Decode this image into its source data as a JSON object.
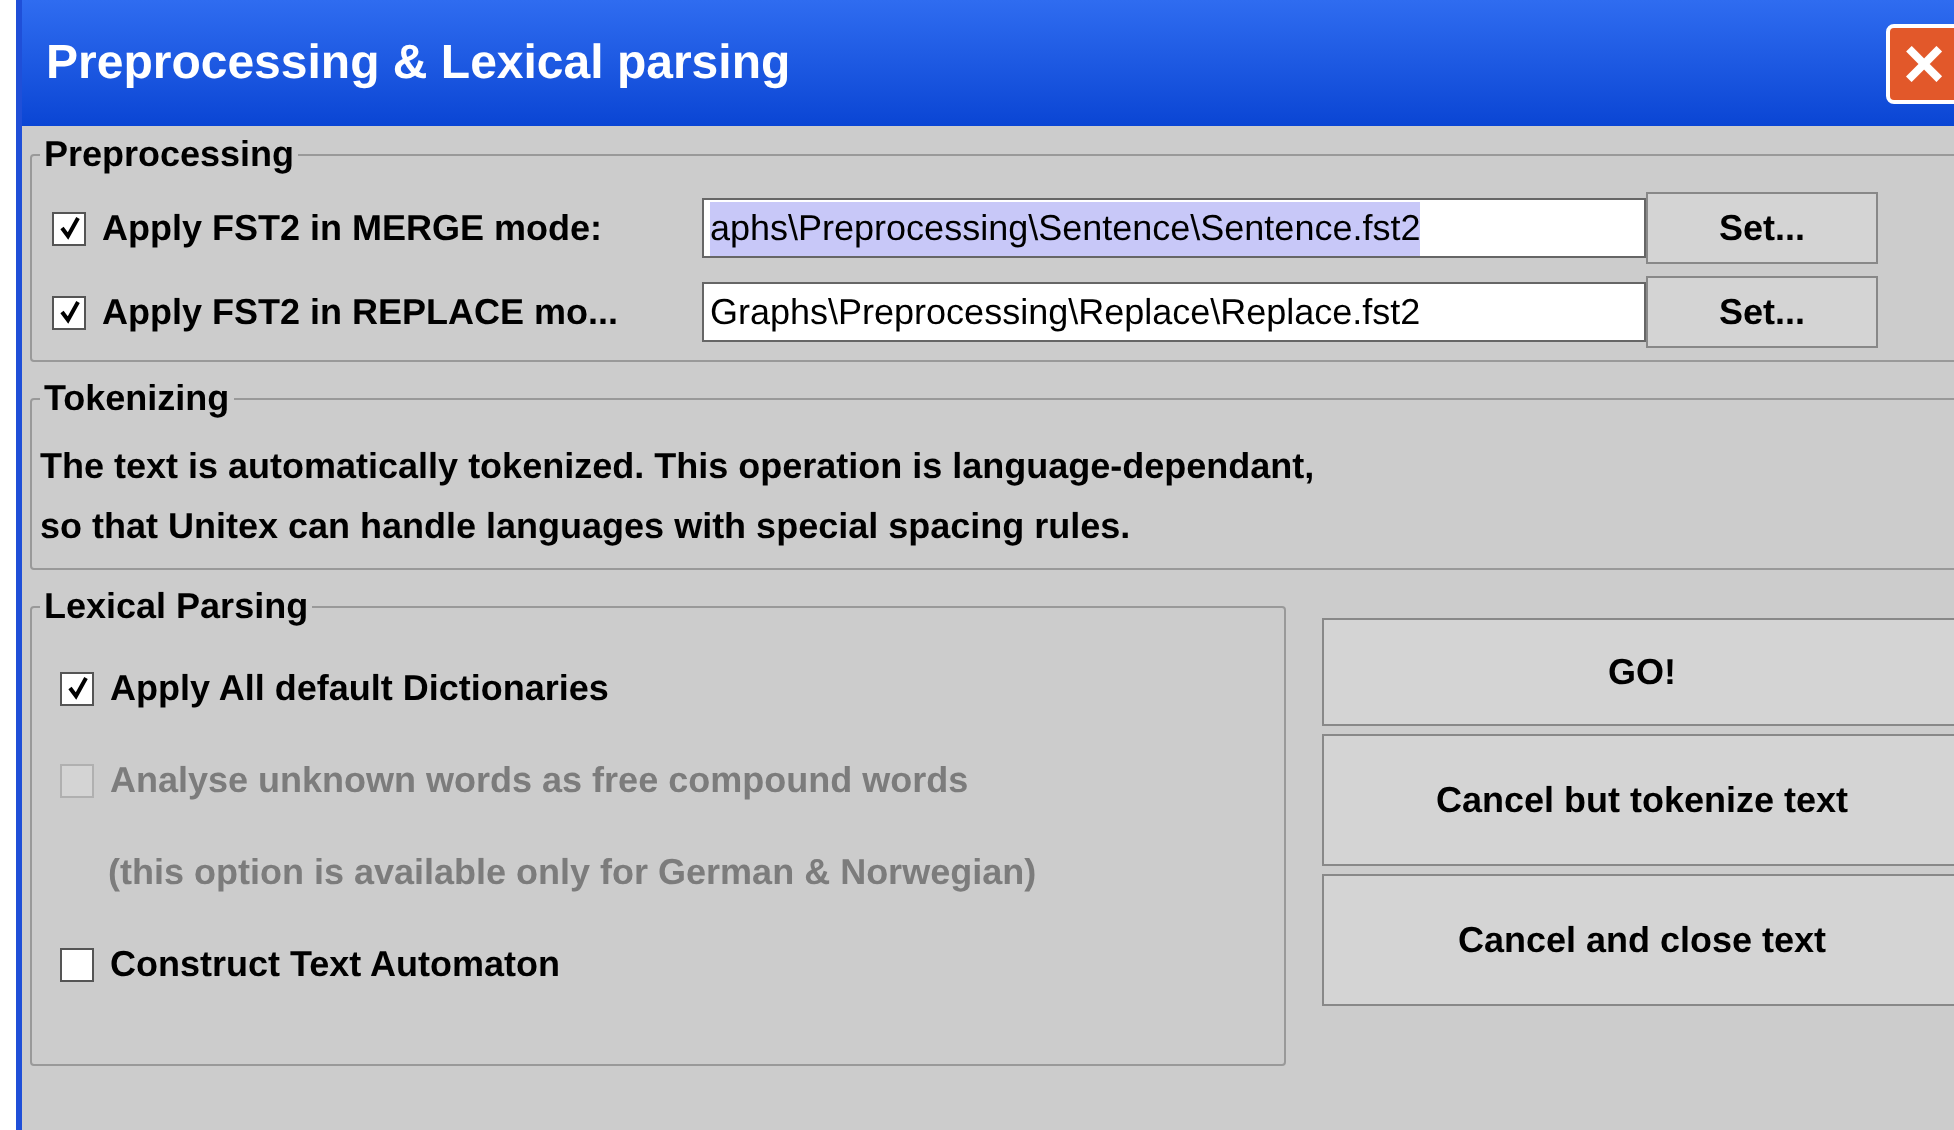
{
  "window": {
    "title": "Preprocessing & Lexical parsing",
    "close": "×"
  },
  "preprocessing": {
    "title": "Preprocessing",
    "rows": [
      {
        "label": "Apply FST2 in MERGE mode:",
        "checked": true,
        "path": "aphs\\Preprocessing\\Sentence\\Sentence.fst2",
        "selected": true,
        "button": "Set..."
      },
      {
        "label": "Apply FST2 in REPLACE mo...",
        "checked": true,
        "path": "Graphs\\Preprocessing\\Replace\\Replace.fst2",
        "selected": false,
        "button": "Set..."
      }
    ]
  },
  "tokenizing": {
    "title": "Tokenizing",
    "lines": [
      "The text is automatically tokenized. This operation is language-dependant,",
      "so that Unitex can handle languages with special spacing rules."
    ]
  },
  "lexical_parsing": {
    "title": "Lexical Parsing",
    "items": [
      {
        "kind": "checkbox",
        "label": "Apply All default Dictionaries",
        "checked": true,
        "disabled": false
      },
      {
        "kind": "checkbox",
        "label": "Analyse unknown words as free compound words",
        "checked": false,
        "disabled": true
      },
      {
        "kind": "note",
        "label": "(this option is available only for German & Norwegian)",
        "disabled": true
      },
      {
        "kind": "checkbox",
        "label": "Construct Text Automaton",
        "checked": false,
        "disabled": false
      }
    ]
  },
  "buttons": [
    "GO!",
    "Cancel but tokenize text",
    "Cancel and close text"
  ]
}
